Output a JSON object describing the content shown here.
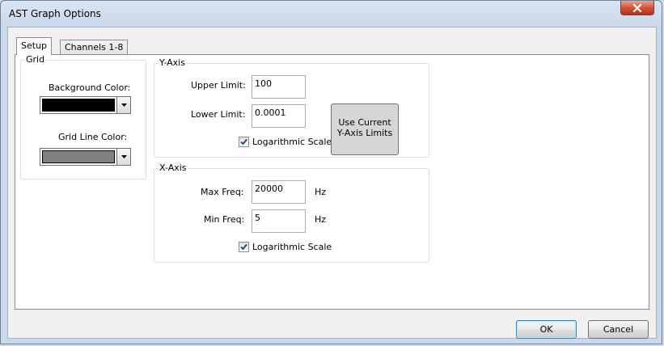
{
  "window": {
    "title": "AST Graph Options"
  },
  "tabs": [
    {
      "label": "Setup",
      "active": true
    },
    {
      "label": "Channels 1-8",
      "active": false
    }
  ],
  "grid": {
    "title": "Grid",
    "background_color_label": "Background Color:",
    "background_color": "#000000",
    "grid_line_color_label": "Grid Line Color:",
    "grid_line_color": "#808080"
  },
  "y_axis": {
    "title": "Y-Axis",
    "upper_limit_label": "Upper Limit:",
    "upper_limit": "100",
    "lower_limit_label": "Lower Limit:",
    "lower_limit": "0.0001",
    "use_current_label_line1": "Use Current",
    "use_current_label_line2": "Y-Axis Limits",
    "log_scale_label": "Logarithmic Scale",
    "log_scale_checked": true
  },
  "x_axis": {
    "title": "X-Axis",
    "max_freq_label": "Max Freq:",
    "max_freq": "20000",
    "max_freq_unit": "Hz",
    "min_freq_label": "Min Freq:",
    "min_freq": "5",
    "min_freq_unit": "Hz",
    "log_scale_label": "Logarithmic Scale",
    "log_scale_checked": true
  },
  "buttons": {
    "ok": "OK",
    "cancel": "Cancel"
  }
}
